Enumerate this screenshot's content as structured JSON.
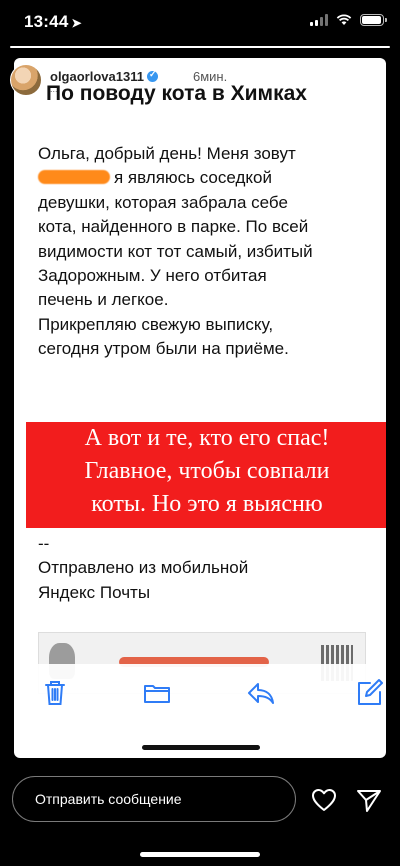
{
  "status_bar": {
    "time": "13:44",
    "location_icon": "location-arrow-icon",
    "signal_icon": "signal-icon",
    "wifi_icon": "wifi-icon",
    "battery_icon": "battery-icon"
  },
  "story": {
    "progress": 1.0,
    "username": "olgaorlova1311",
    "time_ago": "6мин.",
    "subline": "...",
    "close_icon": "close-icon"
  },
  "email": {
    "subject": "По поводу кота в Химках",
    "body_lines": [
      "Ольга, добрый день! Меня зовут",
      "я являюсь соседкой",
      "девушки, которая забрала себе",
      "кота, найденного в парке. По всей",
      "видимости кот тот самый, избитый",
      "Задорожным. У него отбитая",
      "печень и легкое.",
      "Прикрепляю свежую выписку,",
      "сегодня утром были на приёме."
    ],
    "signature_lines": [
      "--",
      "Отправлено из мобильной",
      "Яндекс Почты"
    ]
  },
  "overlay_text": {
    "lines": [
      "А вот и те, кто его спас!",
      "Главное, чтобы совпали",
      "коты. Но это я выясню"
    ],
    "background": "#f21d1d"
  },
  "mail_toolbar": {
    "icons": [
      "trash-icon",
      "folder-icon",
      "reply-icon",
      "compose-icon"
    ],
    "accent": "#2f7cf6"
  },
  "reply_bar": {
    "placeholder": "Отправить сообщение",
    "heart_icon": "heart-icon",
    "send_icon": "send-icon"
  }
}
